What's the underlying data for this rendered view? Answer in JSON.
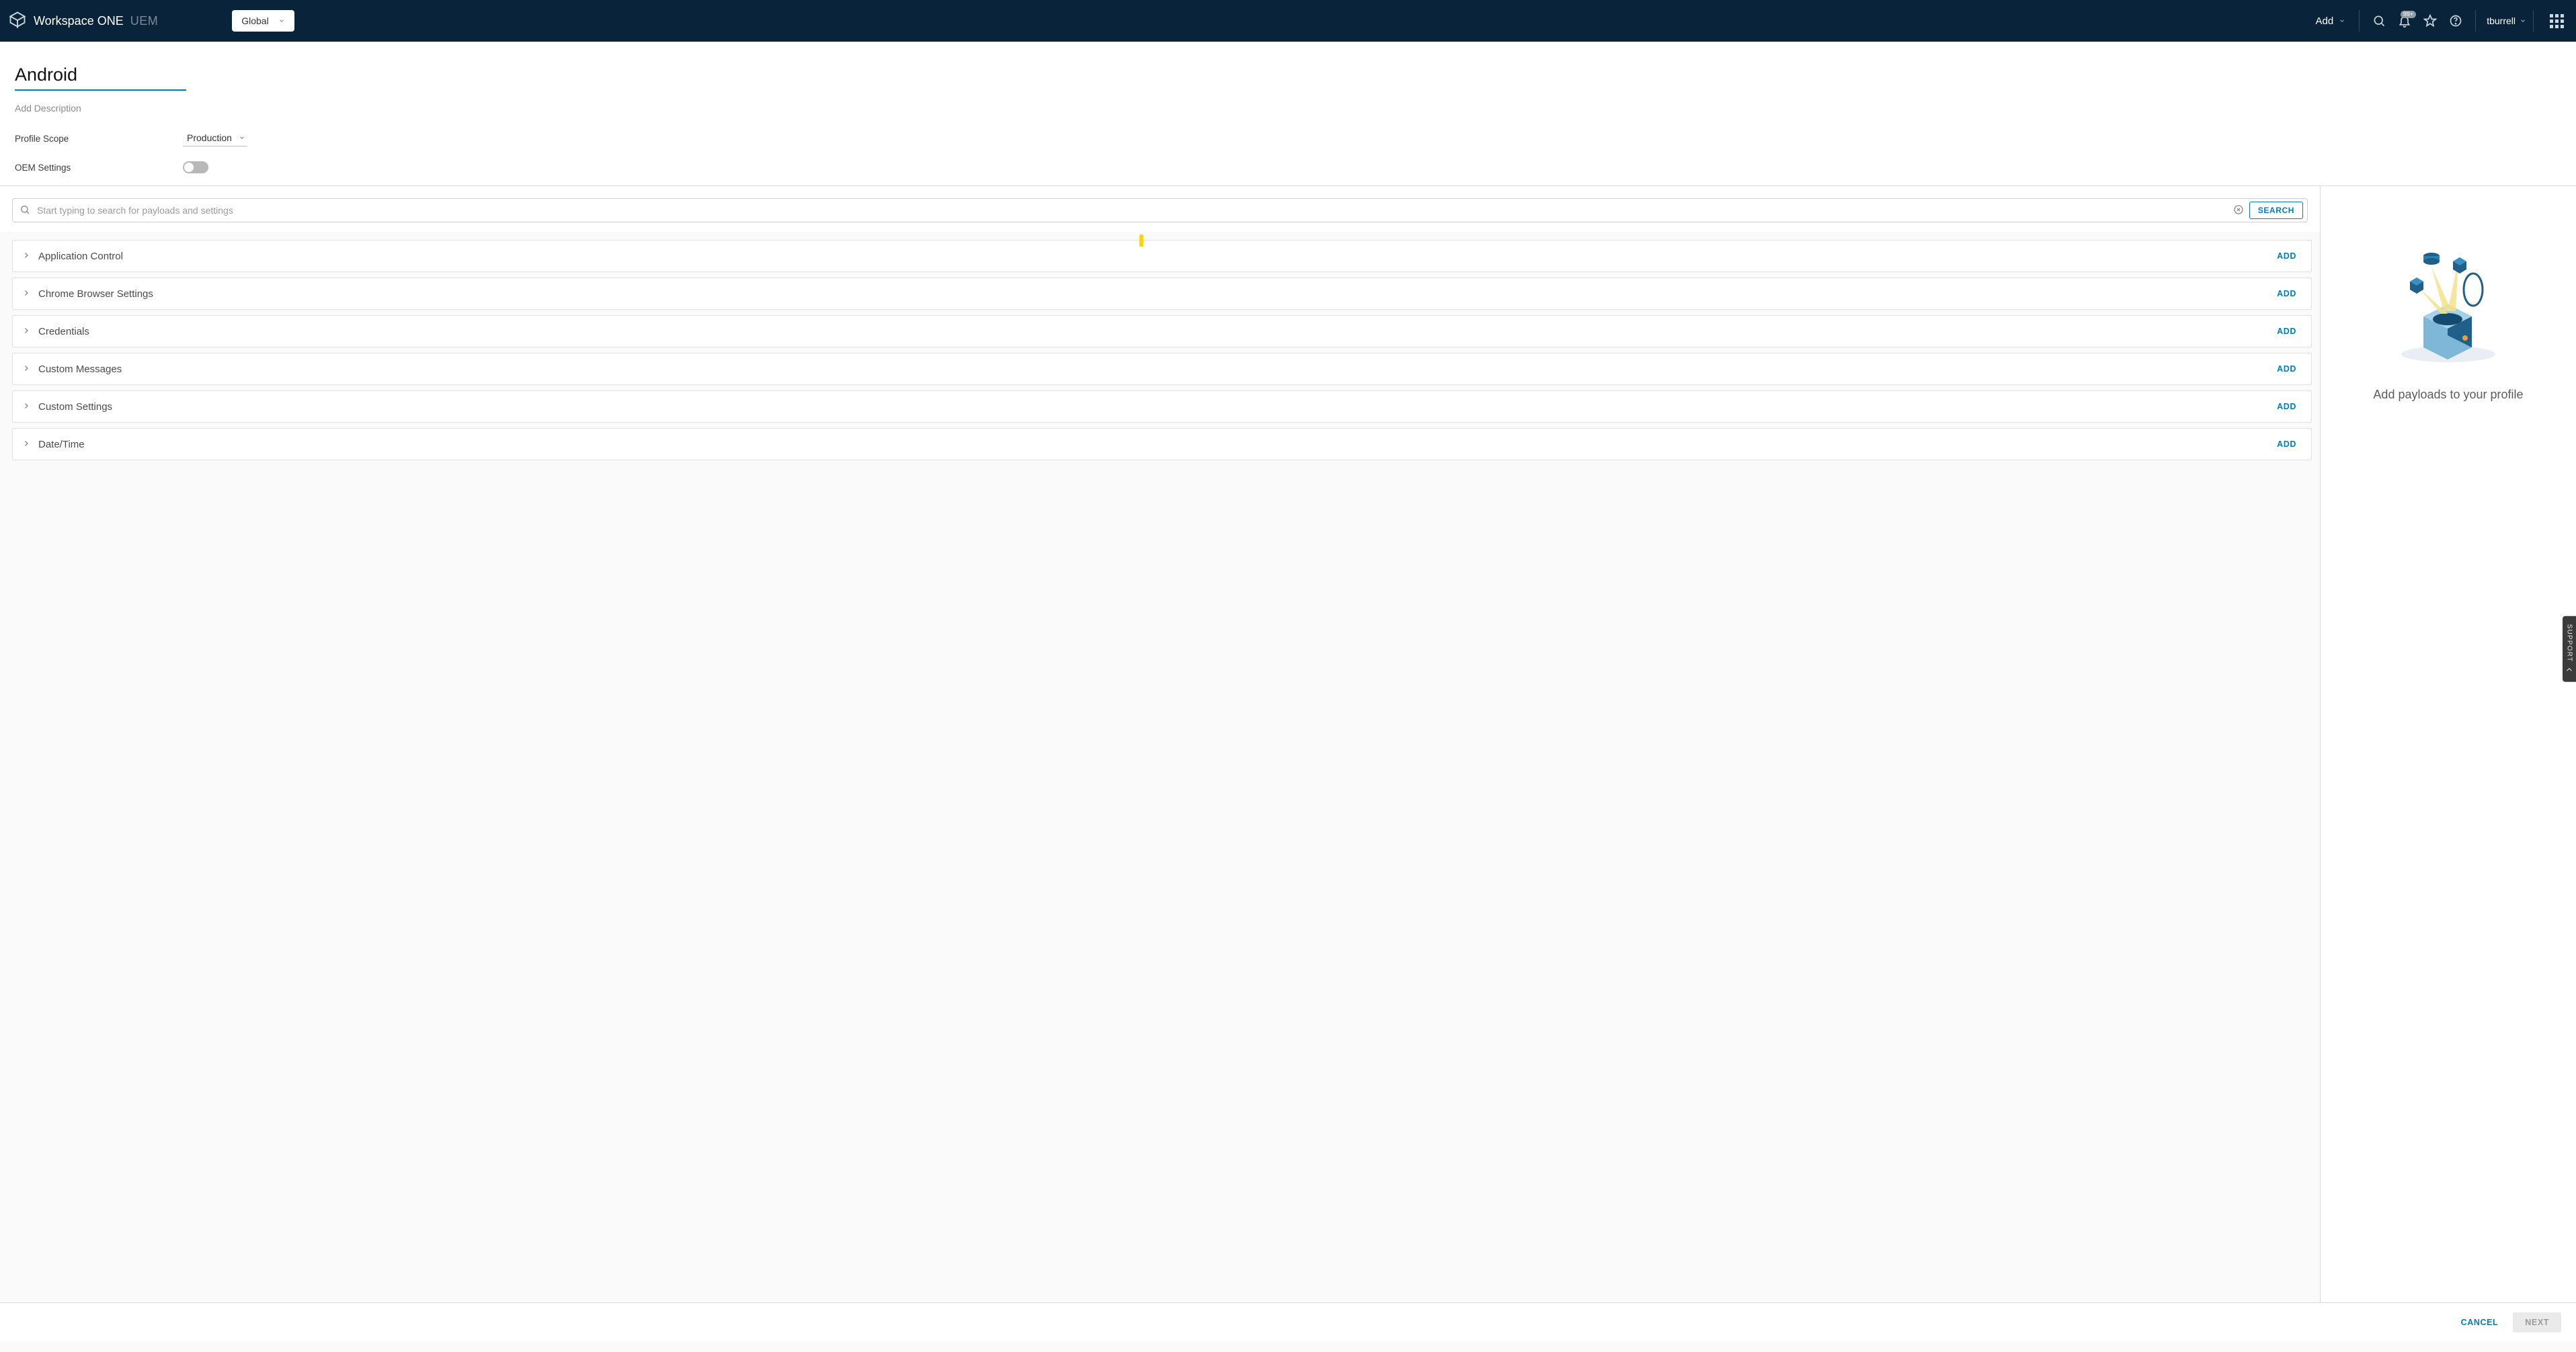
{
  "header": {
    "product_main": "Workspace ONE",
    "product_sub": "UEM",
    "og_selected": "Global",
    "add_menu_label": "Add",
    "notification_badge": "99+",
    "username": "tburrell"
  },
  "page": {
    "title": "Android",
    "description_placeholder": "Add Description",
    "profile_scope_label": "Profile Scope",
    "profile_scope_value": "Production",
    "oem_settings_label": "OEM Settings",
    "oem_settings_on": false
  },
  "search": {
    "placeholder": "Start typing to search for payloads and settings",
    "button_label": "SEARCH"
  },
  "payloads": [
    {
      "name": "Application Control",
      "action": "ADD"
    },
    {
      "name": "Chrome Browser Settings",
      "action": "ADD"
    },
    {
      "name": "Credentials",
      "action": "ADD"
    },
    {
      "name": "Custom Messages",
      "action": "ADD"
    },
    {
      "name": "Custom Settings",
      "action": "ADD"
    },
    {
      "name": "Date/Time",
      "action": "ADD"
    }
  ],
  "right_panel": {
    "hint": "Add payloads to your profile"
  },
  "footer": {
    "cancel": "CANCEL",
    "next": "NEXT"
  },
  "support": {
    "label": "SUPPORT"
  }
}
